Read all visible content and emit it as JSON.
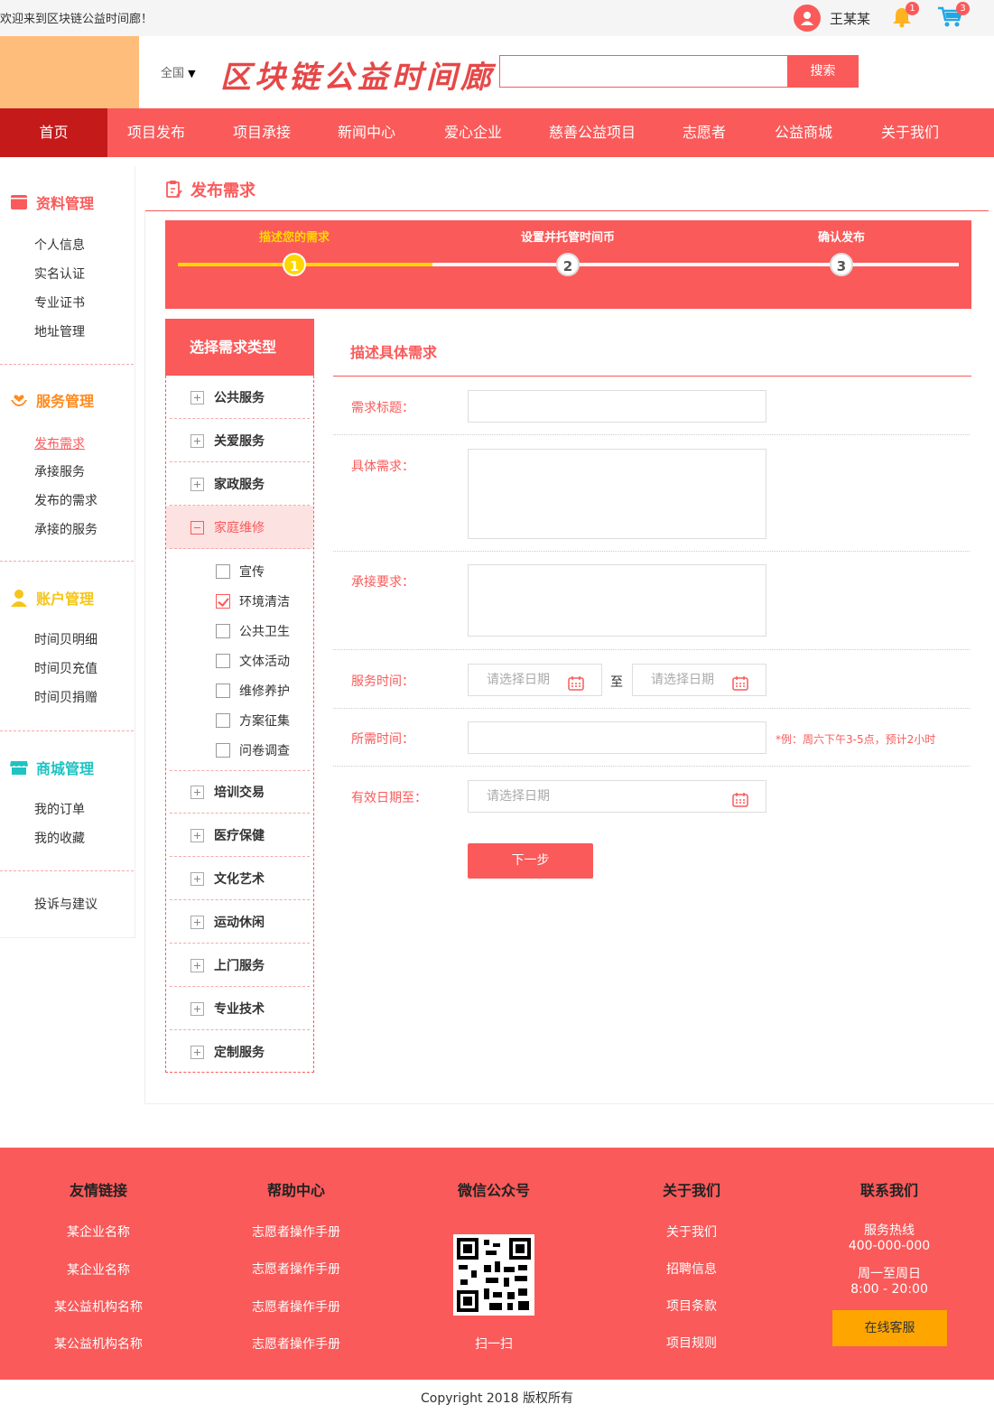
{
  "topbar": {
    "welcome": "欢迎来到区块链公益时间廊！",
    "username": "王某某",
    "notifications": "1",
    "cart_count": "3"
  },
  "header": {
    "region": "全国",
    "site_title": "区块链公益时间廊",
    "search_placeholder": "",
    "search_button": "搜索"
  },
  "nav": {
    "items": [
      "首页",
      "项目发布",
      "项目承接",
      "新闻中心",
      "爱心企业",
      "慈善公益项目",
      "志愿者",
      "公益商城",
      "关于我们"
    ]
  },
  "sidebar": {
    "groups": [
      {
        "title": "资料管理",
        "color": "#fa5a5a",
        "icon": "book-icon",
        "links": [
          "个人信息",
          "实名认证",
          "专业证书",
          "地址管理"
        ]
      },
      {
        "title": "服务管理",
        "color": "#ff8a1e",
        "icon": "heart-hands-icon",
        "links": [
          "发布需求",
          "承接服务",
          "发布的需求",
          "承接的服务"
        ]
      },
      {
        "title": "账户管理",
        "color": "#f5c518",
        "icon": "user-icon",
        "links": [
          "时间贝明细",
          "时间贝充值",
          "时间贝捐赠"
        ]
      },
      {
        "title": "商城管理",
        "color": "#1ec3c3",
        "icon": "shop-icon",
        "links": [
          "我的订单",
          "我的收藏"
        ]
      }
    ],
    "feedback": "投诉与建议"
  },
  "page": {
    "title": "发布需求"
  },
  "steps": {
    "items": [
      {
        "label": "描述您的需求",
        "num": "1"
      },
      {
        "label": "设置并托管时间币",
        "num": "2"
      },
      {
        "label": "确认发布",
        "num": "3"
      }
    ],
    "current": 1
  },
  "categories": {
    "title": "选择需求类型",
    "before": [
      "公共服务",
      "关爱服务",
      "家政服务"
    ],
    "open": "家庭维修",
    "subitems": [
      {
        "label": "宣传",
        "checked": false
      },
      {
        "label": "环境清洁",
        "checked": true
      },
      {
        "label": "公共卫生",
        "checked": false
      },
      {
        "label": "文体活动",
        "checked": false
      },
      {
        "label": "维修养护",
        "checked": false
      },
      {
        "label": "方案征集",
        "checked": false
      },
      {
        "label": "问卷调查",
        "checked": false
      }
    ],
    "after": [
      "培训交易",
      "医疗保健",
      "文化艺术",
      "运动休闲",
      "上门服务",
      "专业技术",
      "定制服务"
    ]
  },
  "form": {
    "title": "描述具体需求",
    "title_label": "需求标题：",
    "detail_label": "具体需求：",
    "requirement_label": "承接要求：",
    "service_time_label": "服务时间：",
    "date_placeholder": "请选择日期",
    "to": "至",
    "duration_label": "所需时间：",
    "duration_hint": "*例：周六下午3-5点，预计2小时",
    "valid_label": "有效日期至：",
    "next_button": "下一步"
  },
  "footer": {
    "columns": [
      {
        "title": "友情链接",
        "links": [
          "某企业名称",
          "某企业名称",
          "某公益机构名称",
          "某公益机构名称"
        ]
      },
      {
        "title": "帮助中心",
        "links": [
          "志愿者操作手册",
          "志愿者操作手册",
          "志愿者操作手册",
          "志愿者操作手册"
        ]
      },
      {
        "title": "微信公众号",
        "links": [
          "扫一扫"
        ]
      },
      {
        "title": "关于我们",
        "links": [
          "关于我们",
          "招聘信息",
          "项目条款",
          "项目规则"
        ]
      },
      {
        "title": "联系我们",
        "links": []
      }
    ],
    "hotline_label": "服务热线",
    "hotline": "400-000-000",
    "hours_label": "周一至周日",
    "hours": "8:00 - 20:00",
    "service_button": "在线客服",
    "copyright": "Copyright 2018 版权所有"
  },
  "colors": {
    "primary": "#fa5a5a",
    "nav_active": "#c41a1a",
    "step_done": "#ffd700",
    "logo_bg": "#ffbd7b",
    "service_button": "#ffa500"
  }
}
